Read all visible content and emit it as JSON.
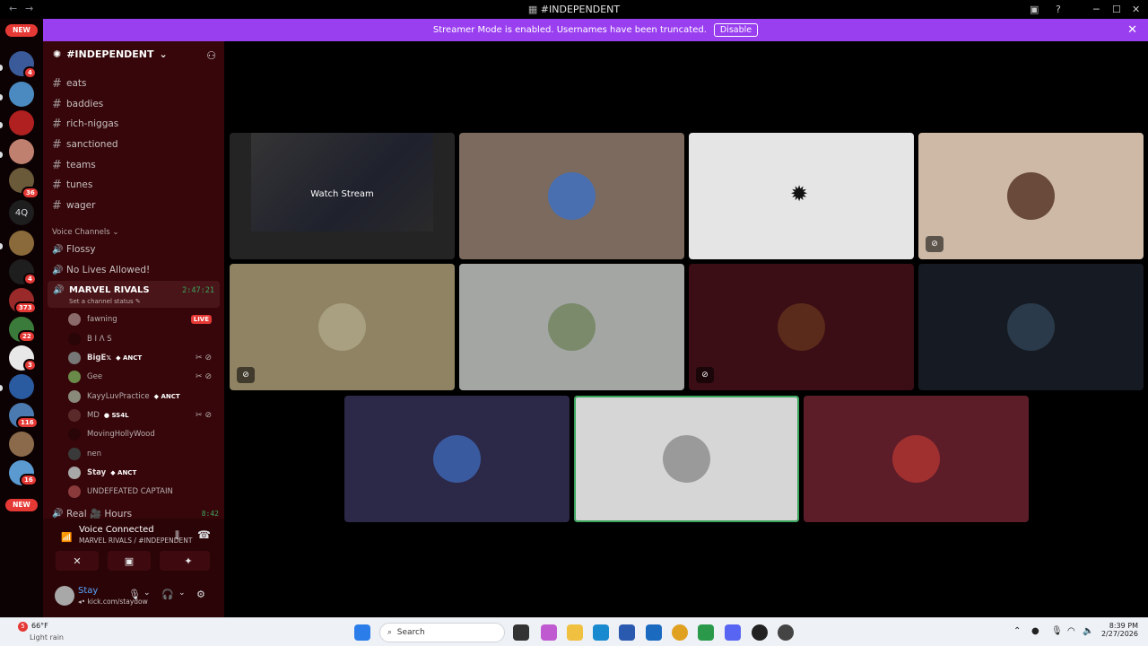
{
  "window": {
    "title": "#INDEPENDENT",
    "back": "←",
    "forward": "→"
  },
  "banner": {
    "text": "Streamer Mode is enabled. Usernames have been truncated.",
    "button": "Disable"
  },
  "guilds": {
    "new_top": "NEW",
    "new_bottom": "NEW",
    "text_guild": "4Q",
    "badges": [
      "4",
      "36",
      "4",
      "373",
      "22",
      "3",
      "116",
      "16"
    ]
  },
  "server": {
    "name": "#INDEPENDENT"
  },
  "channels": [
    {
      "name": "eats"
    },
    {
      "name": "baddies"
    },
    {
      "name": "rich-niggas"
    },
    {
      "name": "sanctioned"
    },
    {
      "name": "teams"
    },
    {
      "name": "tunes"
    },
    {
      "name": "wager"
    }
  ],
  "voice_category": "Voice Channels",
  "voice_channels": [
    {
      "name": "Flossy"
    },
    {
      "name": "No Lives Allowed!"
    }
  ],
  "active_voice": {
    "name": "MARVEL RIVALS",
    "time": "2:47:21",
    "status": "Set a channel status"
  },
  "members": [
    {
      "name": "fawning",
      "live": "LIVE",
      "color": "#8a6a6a"
    },
    {
      "name": "B I Λ S",
      "color": "#2a0508"
    },
    {
      "name": "BigE𝕩",
      "tag": "ANCT",
      "bold": true,
      "color": "#777"
    },
    {
      "name": "Gee",
      "color": "#6a8a4a"
    },
    {
      "name": "KayyLuvPractice",
      "tag": "ANCT",
      "color": "#8a8a7a"
    },
    {
      "name": "MD",
      "tag": "SS4L",
      "color": "#5a2a2a"
    },
    {
      "name": "MovingHollyWood",
      "color": "#2a0508"
    },
    {
      "name": "nen",
      "color": "#3a3a3a"
    },
    {
      "name": "Stay",
      "tag": "ANCT",
      "bold": true,
      "color": "#a8a8a8"
    },
    {
      "name": "UNDEFEATED CAPTAIN",
      "color": "#8a3a3a"
    }
  ],
  "next_channel": {
    "name": "Real 🎥 Hours",
    "time": "8:42"
  },
  "voice_panel": {
    "title": "Voice Connected",
    "subtitle": "MARVEL RIVALS / #INDEPENDENT"
  },
  "user": {
    "name": "Stay",
    "status": "kick.com/staydow"
  },
  "stream": {
    "watch_label": "Watch Stream"
  },
  "tiles": [
    {
      "bg": "#7b6a5d",
      "avatar": "#4a6fb0"
    },
    {
      "bg": "#e5e5e5",
      "avatar": "#e5e5e5"
    },
    {
      "bg": "#cdb9a6",
      "avatar": "#6a4a3a",
      "badge": true
    },
    {
      "bg": "#8f8363",
      "avatar": "#a8a080",
      "badge": true
    },
    {
      "bg": "#a3a6a3",
      "avatar": "#7a8a6a"
    },
    {
      "bg": "#3b0d15",
      "avatar": "#5a2a1a",
      "badge": true
    },
    {
      "bg": "#161a22",
      "avatar": "#2a3a4a"
    },
    {
      "bg": "#2c2848",
      "avatar": "#3a5aa0"
    },
    {
      "bg": "#d6d6d6",
      "avatar": "#9a9a9a",
      "speaking": true
    },
    {
      "bg": "#5c1d28",
      "avatar": "#a03030"
    }
  ],
  "taskbar": {
    "weather_temp": "66°F",
    "weather_desc": "Light rain",
    "weather_badge": "5",
    "search": "Search",
    "time": "8:39 PM",
    "date": "2/27/2026"
  },
  "colors": {
    "accent": "#9a3ff0",
    "sidebar": "#36060a",
    "speaking": "#3ba55d",
    "live": "#e53935"
  }
}
